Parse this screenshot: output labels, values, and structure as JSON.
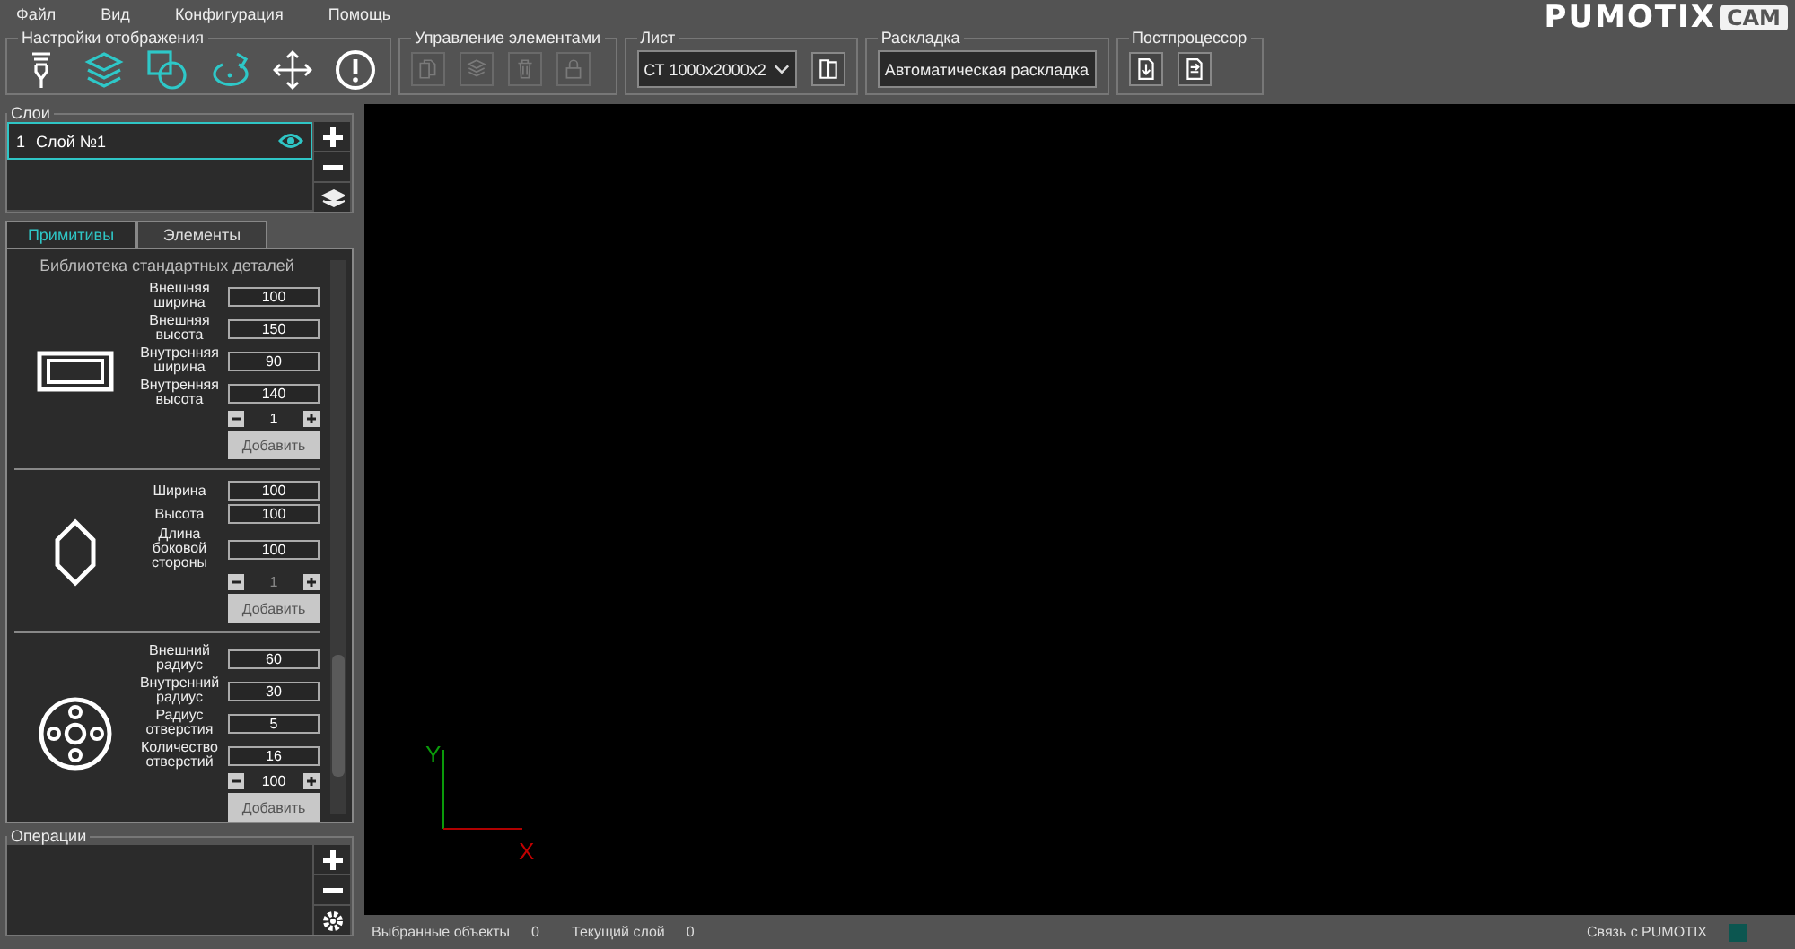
{
  "menu": [
    "Файл",
    "Вид",
    "Конфигурация",
    "Помощь"
  ],
  "toolbar": [
    {
      "title": "Настройки отображения",
      "tools": [
        {
          "kind": "spindle",
          "on": false
        },
        {
          "kind": "layers",
          "on": true
        },
        {
          "kind": "shapes",
          "on": true
        },
        {
          "kind": "rotate",
          "on": true
        },
        {
          "kind": "move",
          "on": false
        },
        {
          "kind": "info",
          "on": false
        }
      ]
    },
    {
      "title": "Управление элементами",
      "tools": [
        {
          "kind": "copy",
          "disabled": true
        },
        {
          "kind": "stack",
          "disabled": true
        },
        {
          "kind": "trash",
          "disabled": true
        },
        {
          "kind": "lock",
          "disabled": true
        }
      ]
    },
    {
      "title": "Лист",
      "select": "СТ 1000х2000х2",
      "tools": [
        {
          "kind": "book",
          "disabled": false
        }
      ]
    },
    {
      "title": "Раскладка",
      "field": "Автоматическая раскладка"
    },
    {
      "title": "Постпроцессор",
      "tools": [
        {
          "kind": "import",
          "disabled": false
        },
        {
          "kind": "export",
          "disabled": false
        }
      ]
    }
  ],
  "logo": {
    "name": "PUMOTIX",
    "badge": "CAM"
  },
  "layers": {
    "title": "Слои",
    "items": [
      {
        "number": "1",
        "name": "Слой №1",
        "selected": true,
        "visible": true
      }
    ]
  },
  "tabs": [
    {
      "label": "Примитивы",
      "selected": true
    },
    {
      "label": "Элементы",
      "selected": false
    }
  ],
  "library": {
    "title": "Библиотека стандартных деталей",
    "parts": [
      {
        "kind": "frame",
        "fields": [
          {
            "label": "Внешняя ширина",
            "value": "100"
          },
          {
            "label": "Внешняя высота",
            "value": "150"
          },
          {
            "label": "Внутренняя ширина",
            "value": "90"
          },
          {
            "label": "Внутренняя высота",
            "value": "140"
          }
        ],
        "count": "1",
        "count_disabled": false,
        "add": "Добавить"
      },
      {
        "kind": "hexagon",
        "fields": [
          {
            "label": "Ширина",
            "value": "100"
          },
          {
            "label": "Высота",
            "value": "100"
          },
          {
            "label": "Длина боковой стороны",
            "value": "100"
          }
        ],
        "count": "1",
        "count_disabled": true,
        "add": "Добавить"
      },
      {
        "kind": "flange",
        "fields": [
          {
            "label": "Внешний радиус",
            "value": "60"
          },
          {
            "label": "Внутренний радиус",
            "value": "30"
          },
          {
            "label": "Радиус отверстия",
            "value": "5"
          },
          {
            "label": "Количество отверстий",
            "value": "16"
          }
        ],
        "count": "100",
        "count_disabled": false,
        "add": "Добавить"
      }
    ]
  },
  "operations": {
    "title": "Операции"
  },
  "axes": {
    "y": "Y",
    "x": "X"
  },
  "status": [
    {
      "label": "Выбранные объекты",
      "value": "0"
    },
    {
      "label": "Текущий слой",
      "value": "0"
    }
  ],
  "connection": "Связь с PUMOTIX"
}
